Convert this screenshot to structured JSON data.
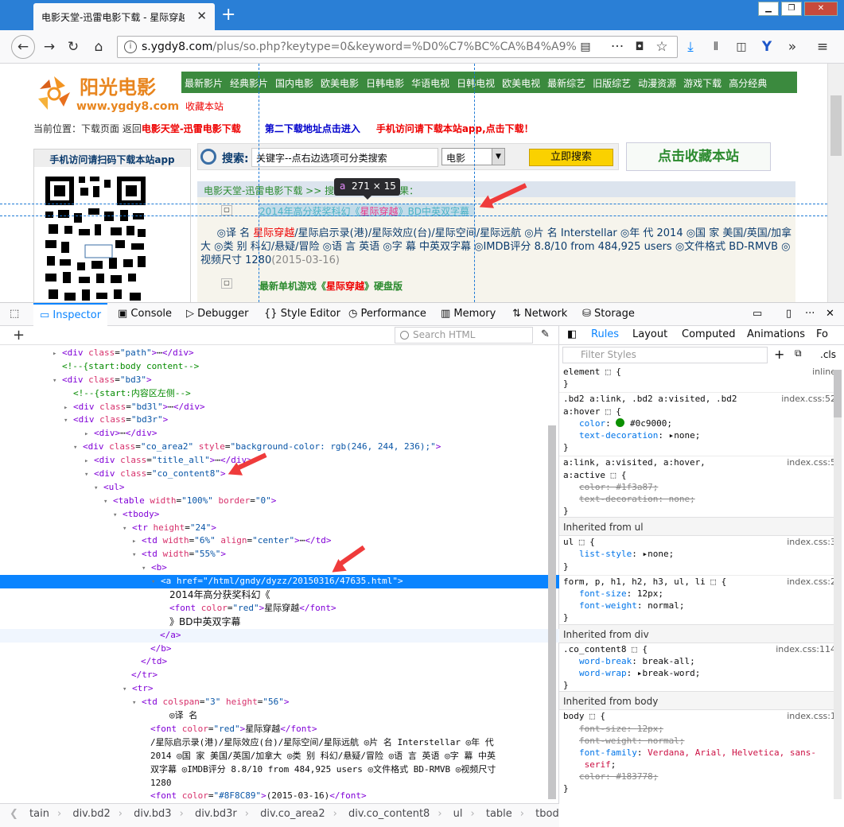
{
  "browser": {
    "tab_title": "电影天堂-迅雷电影下载 - 星际穿越",
    "new_tab": "+",
    "url_domain": "s.ygdy8.com",
    "url_path": "/plus/so.php?keytype=0&keyword=%D0%C7%BC%CA%B4%A9%"
  },
  "site": {
    "logo_cn": "阳光电影",
    "logo_en": "www.ygdy8.com",
    "nav": [
      "最新影片",
      "经典影片",
      "国内电影",
      "欧美电影",
      "日韩电影",
      "华语电视",
      "日韩电视",
      "欧美电视",
      "最新综艺",
      "旧版综艺",
      "动漫资源",
      "游戏下载",
      "高分经典"
    ],
    "fav": "收藏本站",
    "crumb_prefix": "当前位置：下载页面 返回",
    "crumb_link": "电影天堂-迅雷电影下载",
    "crumb_blue": "第二下载地址点击进入",
    "crumb_app": "手机访问请下载本站app,点击下载！",
    "app_title": "手机访问请扫码下载本站app",
    "search_label": "搜索:",
    "search_placeholder": "关键字--点右边选项可分类搜索",
    "search_select": "电影",
    "search_button": "立即搜索",
    "big_fav": "点击收藏本站",
    "results_head": "电影天堂-迅雷电影下载 >> 搜",
    "results_tail": "结果：",
    "row1_pre": "2014年高分获奖科幻《",
    "row1_red": "星际穿越",
    "row1_post": "》BD中英双字幕",
    "desc_a": "◎译 名 ",
    "desc_red": "星际穿越",
    "desc_b": "/星际启示录(港)/星际效应(台)/星际空间/星际远航 ◎片 名 Interstellar ◎年 代 2014 ◎国 家 美国/英国/加拿大 ◎类 别 科幻/悬疑/冒险 ◎语 言 英语 ◎字 幕 中英双字幕 ◎IMDB评分 8.8/10 from 484,925 users ◎文件格式 BD-RMVB ◎视频尺寸 1280",
    "desc_date": "(2015-03-16)",
    "row2_pre": "最新单机游戏《",
    "row2_red": "星际穿越",
    "row2_post": "》硬盘版"
  },
  "tooltip": {
    "tag": "a",
    "size": "271 × 15"
  },
  "devtools": {
    "tabs": [
      "Inspector",
      "Console",
      "Debugger",
      "Style Editor",
      "Performance",
      "Memory",
      "Network",
      "Storage"
    ],
    "search_html": "Search HTML",
    "rules_tabs": [
      "Rules",
      "Layout",
      "Computed",
      "Animations",
      "Fo"
    ],
    "filter_styles": "Filter Styles",
    "cls": ".cls"
  },
  "breadcrumb": [
    "tain",
    "div.bd2",
    "div.bd3",
    "div.bd3r",
    "div.co_area2",
    "div.co_content8",
    "ul",
    "table",
    "tbody",
    "tr",
    "td",
    "b",
    "a"
  ],
  "colors": {
    "accent": "#0a84ff",
    "site_green": "#3b8a3e",
    "link_red": "#e00"
  }
}
